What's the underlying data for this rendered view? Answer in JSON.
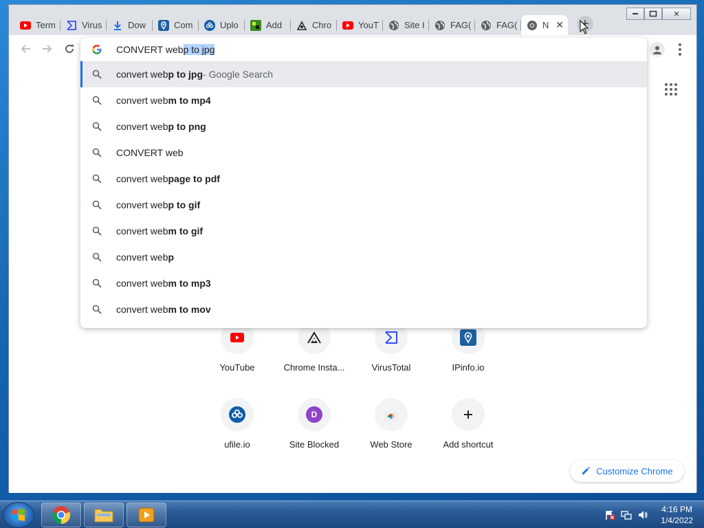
{
  "window": {
    "controls": {
      "minimize": "▭",
      "maximize": "▢",
      "close": "✕"
    }
  },
  "tabs": [
    {
      "title": "Term",
      "icon": "youtube-icon",
      "color": "#ff0000"
    },
    {
      "title": "Virus",
      "icon": "virustotal-icon",
      "color": "#394eff"
    },
    {
      "title": "Dow",
      "icon": "download-icon",
      "color": "#1a73e8"
    },
    {
      "title": "Com",
      "icon": "ipinfo-icon",
      "color": "#1e5fa0"
    },
    {
      "title": "Uplo",
      "icon": "ufile-icon",
      "color": "#0e5ea8"
    },
    {
      "title": "Add",
      "icon": "puzzle-icon",
      "color": "#3a8a1a"
    },
    {
      "title": "Chro",
      "icon": "chrome-installer-icon",
      "color": "#333333"
    },
    {
      "title": "YouT",
      "icon": "youtube-icon",
      "color": "#ff0000"
    },
    {
      "title": "Site I",
      "icon": "globe-icon",
      "color": "#5f6368"
    },
    {
      "title": "FAG(",
      "icon": "globe-icon",
      "color": "#5f6368"
    },
    {
      "title": "FAG(",
      "icon": "globe-icon",
      "color": "#5f6368"
    },
    {
      "title": "N",
      "icon": "chrome-icon",
      "color": "#5f6368",
      "active": true
    }
  ],
  "newtab_label": "+",
  "omnibox": {
    "typed": "CONVERT web",
    "autocomplete": "p to jpg",
    "suggestions": [
      {
        "prefix": "convert web",
        "bold": "p to jpg",
        "desc": " - Google Search"
      },
      {
        "prefix": "convert web",
        "bold": "m to mp4",
        "desc": ""
      },
      {
        "prefix": "convert web",
        "bold": "p to png",
        "desc": ""
      },
      {
        "prefix": "CONVERT web",
        "bold": "",
        "desc": ""
      },
      {
        "prefix": "convert web",
        "bold": "page to pdf",
        "desc": ""
      },
      {
        "prefix": "convert web",
        "bold": "p to gif",
        "desc": ""
      },
      {
        "prefix": "convert web",
        "bold": "m to gif",
        "desc": ""
      },
      {
        "prefix": "convert web",
        "bold": "p",
        "desc": ""
      },
      {
        "prefix": "convert web",
        "bold": "m to mp3",
        "desc": ""
      },
      {
        "prefix": "convert web",
        "bold": "m to mov",
        "desc": ""
      }
    ]
  },
  "shortcuts": [
    {
      "label": "YouTube",
      "icon": "youtube-icon"
    },
    {
      "label": "Chrome Insta...",
      "icon": "chrome-installer-icon"
    },
    {
      "label": "VirusTotal",
      "icon": "virustotal-icon"
    },
    {
      "label": "IPinfo.io",
      "icon": "ipinfo-icon"
    },
    {
      "label": "ufile.io",
      "icon": "ufile-icon"
    },
    {
      "label": "Site Blocked",
      "icon": "letter-d-icon",
      "letter": "D"
    },
    {
      "label": "Web Store",
      "icon": "web-store-icon"
    },
    {
      "label": "Add shortcut",
      "icon": "plus-icon"
    }
  ],
  "customize_label": "Customize Chrome",
  "taskbar": {
    "clock_time": "4:16 PM",
    "clock_date": "1/4/2022"
  }
}
